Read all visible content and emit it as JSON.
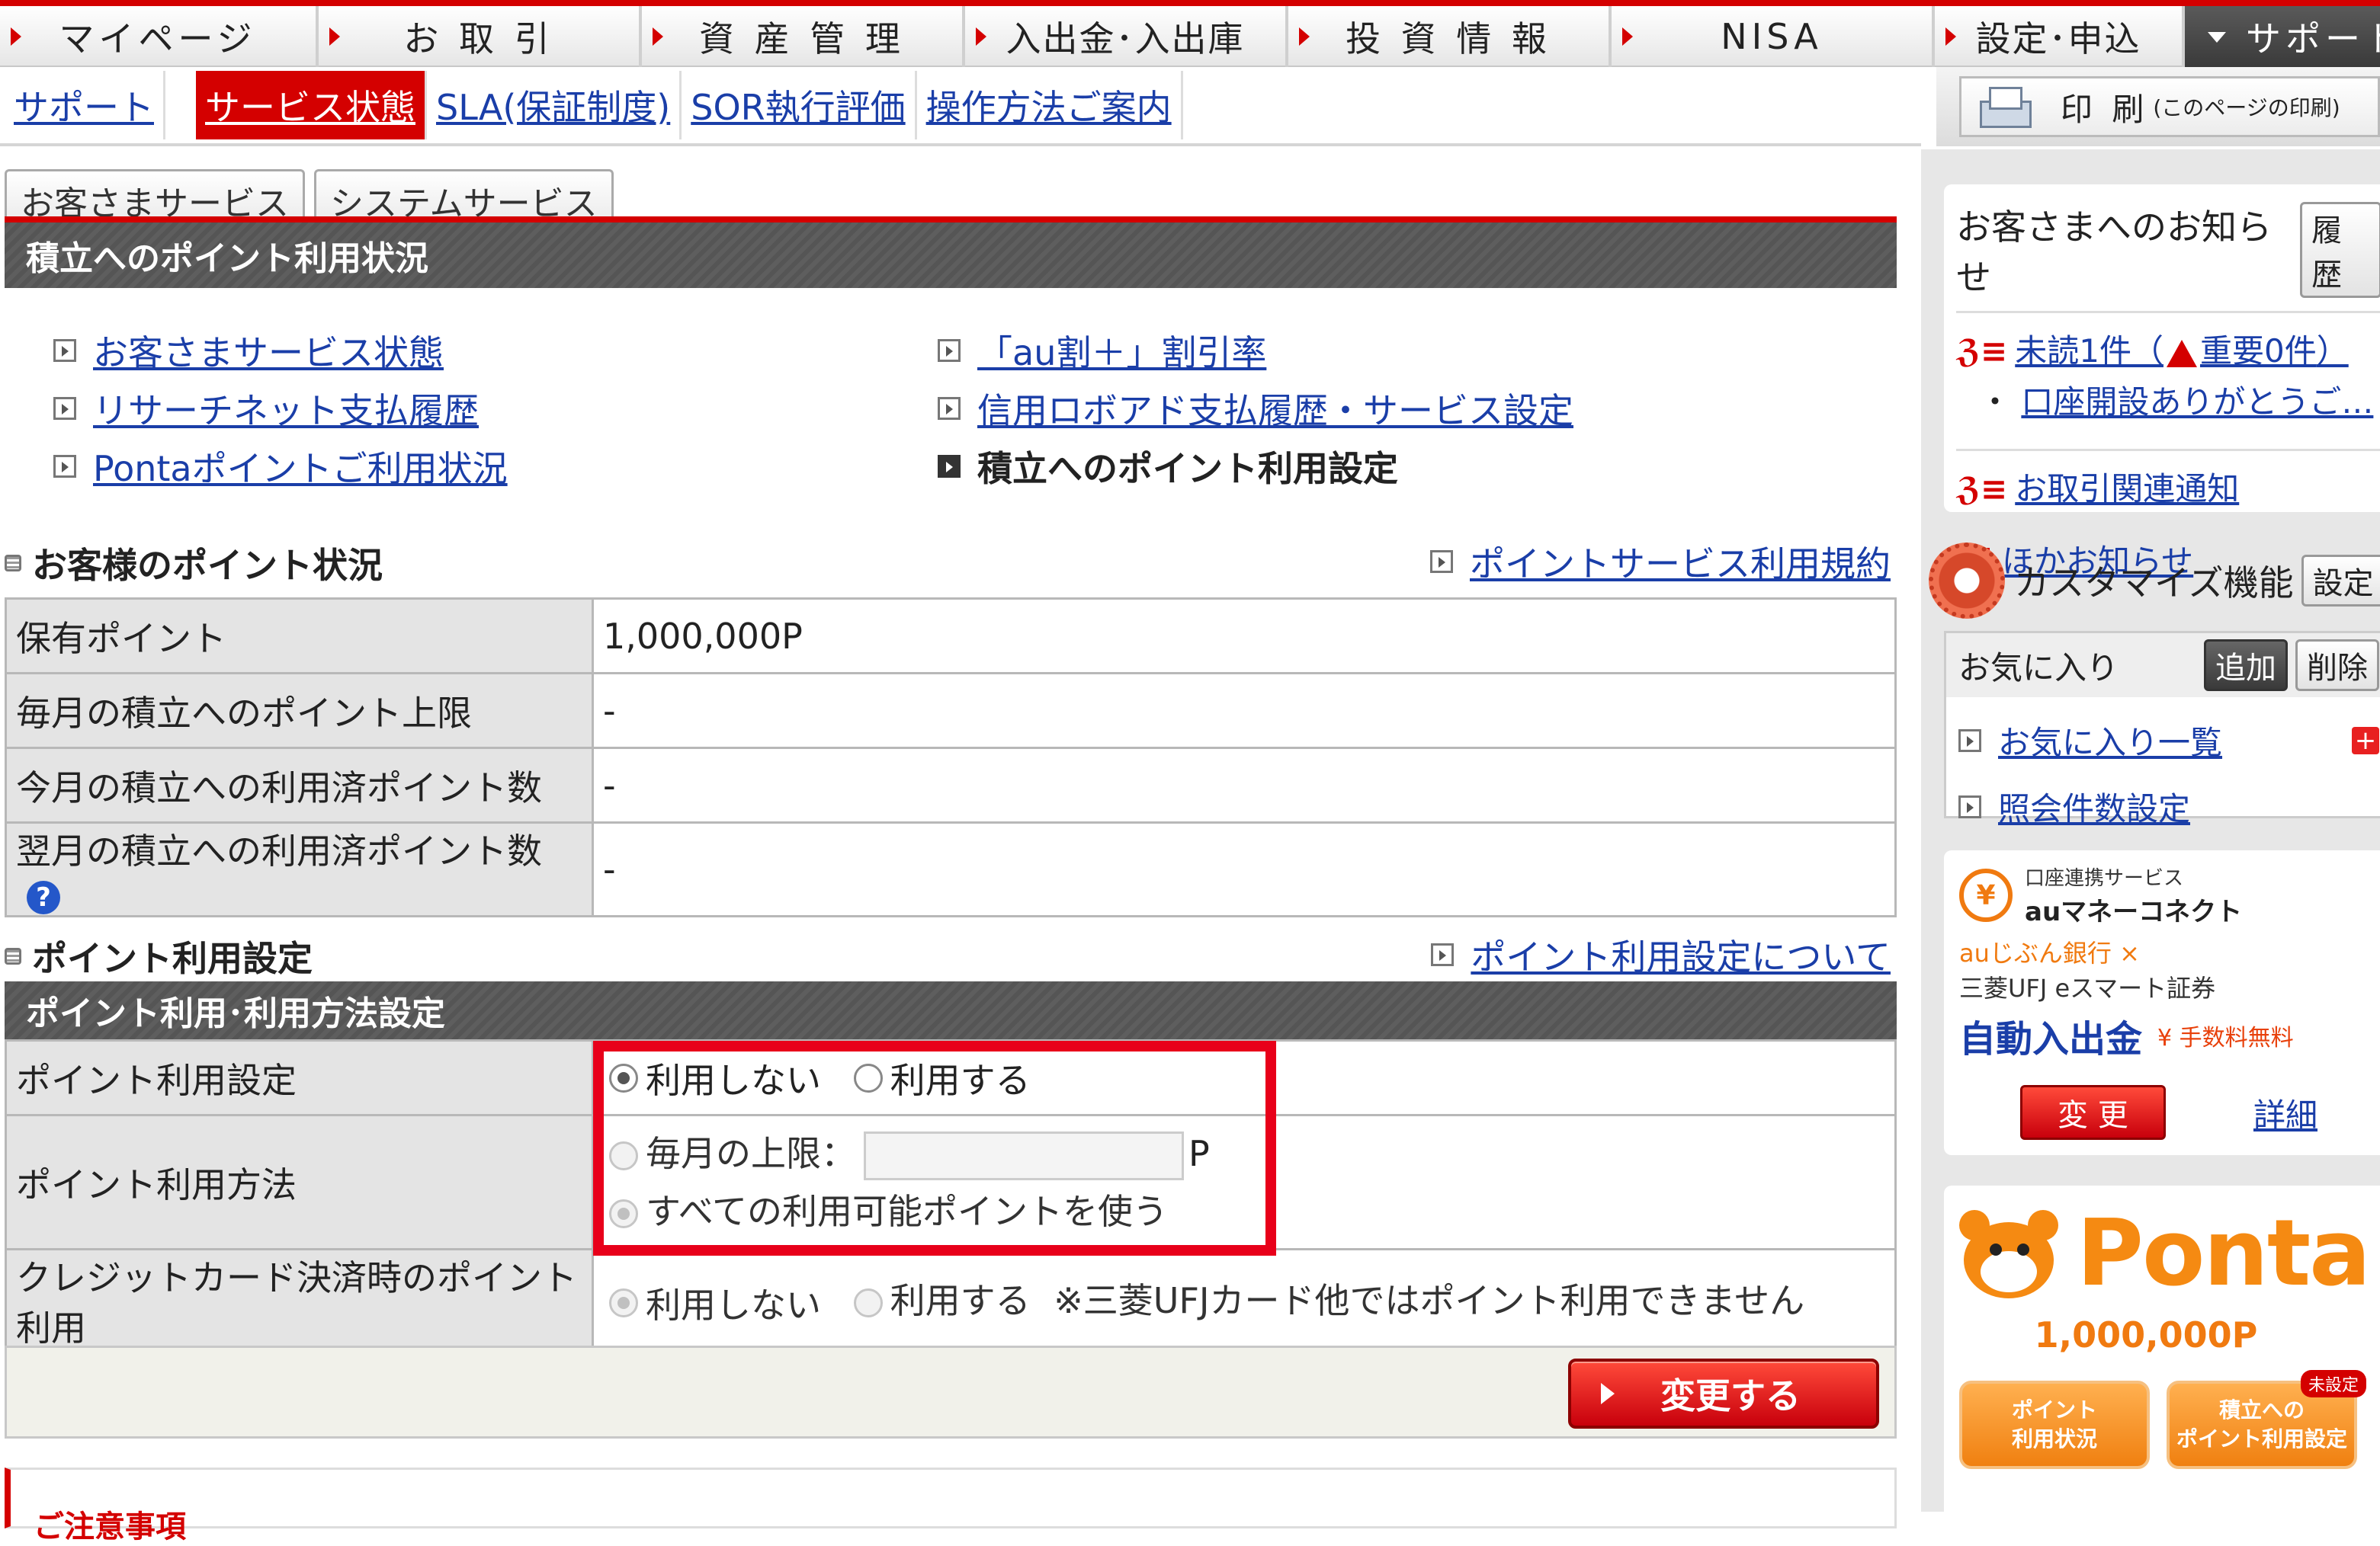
{
  "topnav": {
    "tabs": [
      "マイページ",
      "お 取 引",
      "資 産 管 理",
      "入出金･入出庫",
      "投 資 情 報",
      "NISA",
      "設定･申込",
      "サポート"
    ]
  },
  "subnav": {
    "items": [
      "サポート",
      "サービス状態",
      "SLA(保証制度)",
      "SOR執行評価",
      "操作方法ご案内"
    ],
    "active_index": 1
  },
  "print": {
    "label": "印 刷",
    "sub": "(このページの印刷)"
  },
  "service_tabs": [
    "お客さまサービス",
    "システムサービス"
  ],
  "page_title": "積立へのポイント利用状況",
  "links": {
    "left": [
      "お客さまサービス状態",
      "リサーチネット支払履歴",
      "Pontaポイントご利用状況"
    ],
    "right": [
      "「au割＋」割引率",
      "信用ロボアド支払履歴・サービス設定",
      "積立へのポイント利用設定"
    ]
  },
  "points_status": {
    "heading": "お客様のポイント状況",
    "terms_link": "ポイントサービス利用規約",
    "rows": [
      {
        "label": "保有ポイント",
        "value": "1,000,000P"
      },
      {
        "label": "毎月の積立へのポイント上限",
        "value": "-"
      },
      {
        "label": "今月の積立への利用済ポイント数",
        "value": "-"
      },
      {
        "label": "翌月の積立への利用済ポイント数",
        "value": "-"
      }
    ],
    "help": "?"
  },
  "settings": {
    "heading": "ポイント利用設定",
    "about_link": "ポイント利用設定について",
    "bar_title": "ポイント利用･利用方法設定",
    "row1_label": "ポイント利用設定",
    "opt_no": "利用しない",
    "opt_yes": "利用する",
    "row2_label": "ポイント利用方法",
    "monthly_limit": "毎月の上限：",
    "unit": "P",
    "use_all": "すべての利用可能ポイントを使う",
    "row3_label": "クレジットカード決済時のポイント利用",
    "card_note": "※三菱UFJカード他ではポイント利用できません",
    "submit": "変更する"
  },
  "notice_title": "ご注意事項",
  "sidebar": {
    "notice_title": "お客さまへのお知らせ",
    "history_btn": "履歴",
    "unread_prefix": "未読1件（",
    "important": "重要0件",
    "unread_suffix": "）",
    "latest": "口座開設ありがとうご…",
    "trade_notice": "お取引関連通知",
    "other_notice": "ほかお知らせ",
    "customize_title": "カスタマイズ機能",
    "setting_btn": "設定",
    "favorites": "お気に入り",
    "add_btn": "追加",
    "delete_btn": "削除",
    "fav_list": "お気に入り一覧",
    "count_setting": "照会件数設定",
    "au_small": "口座連携サービス",
    "au_title": "auマネーコネクト",
    "bank": "auじぶん銀行 ×",
    "securities": "三菱UFJ eスマート証券",
    "auto": "自動入出金",
    "fee": "手数料無料",
    "change_btn": "変 更",
    "detail": "詳細",
    "ponta_logo": "Ponta",
    "ponta_points": "1,000,000P",
    "btn1_l1": "ポイント",
    "btn1_l2": "利用状況",
    "btn2_l1": "積立への",
    "btn2_l2": "ポイント利用設定",
    "unset": "未設定"
  }
}
